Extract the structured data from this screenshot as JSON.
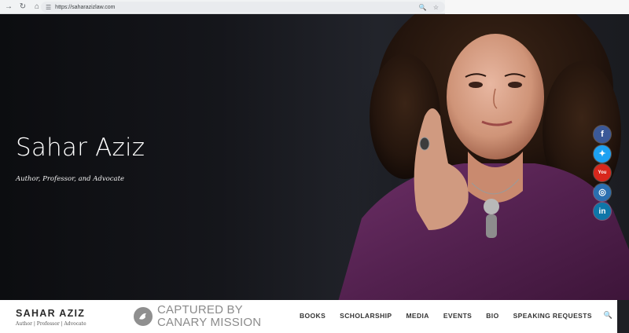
{
  "browser": {
    "url": "https://saharazizlaw.com",
    "icons": [
      "back-icon",
      "reload-icon",
      "home-icon",
      "site-settings-icon",
      "zoom-icon",
      "bookmark-star-icon"
    ]
  },
  "hero": {
    "title": "Sahar Aziz",
    "subtitle": "Author, Professor, and Advocate"
  },
  "social": [
    {
      "name": "facebook",
      "glyph": "f",
      "color": "#3b5998"
    },
    {
      "name": "twitter",
      "glyph": "🐦",
      "color": "#1da1f2"
    },
    {
      "name": "youtube",
      "glyph": "You",
      "color": "#d8271c"
    },
    {
      "name": "instagram",
      "glyph": "◎",
      "color": "#2a6fb0"
    },
    {
      "name": "linkedin",
      "glyph": "in",
      "color": "#0e76a8"
    }
  ],
  "sitebar": {
    "site_name": "SAHAR AZIZ",
    "tagline": "Author | Professor | Advocate",
    "badge_line1": "CAPTURED BY",
    "badge_line2": "CANARY MISSION",
    "nav": [
      "BOOKS",
      "SCHOLARSHIP",
      "MEDIA",
      "EVENTS",
      "BIO",
      "SPEAKING REQUESTS"
    ]
  }
}
